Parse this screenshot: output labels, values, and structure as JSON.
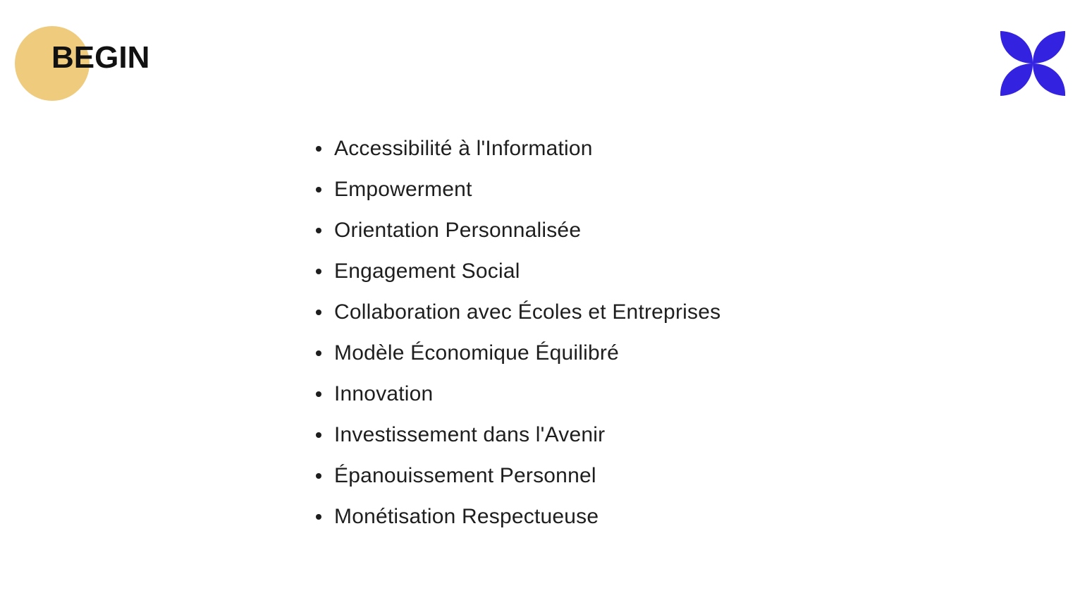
{
  "brand": {
    "title": "BEGIN",
    "circle_color": "#EFCB7E"
  },
  "logo": {
    "icon": "flower-logo-icon",
    "color": "#3322E0"
  },
  "list": {
    "items": [
      {
        "label": "Accessibilité à l'Information"
      },
      {
        "label": "Empowerment"
      },
      {
        "label": "Orientation Personnalisée"
      },
      {
        "label": "Engagement Social"
      },
      {
        "label": "Collaboration avec Écoles et Entreprises"
      },
      {
        "label": "Modèle Économique Équilibré"
      },
      {
        "label": "Innovation"
      },
      {
        "label": "Investissement dans l'Avenir"
      },
      {
        "label": "Épanouissement Personnel"
      },
      {
        "label": "Monétisation Respectueuse"
      }
    ]
  }
}
